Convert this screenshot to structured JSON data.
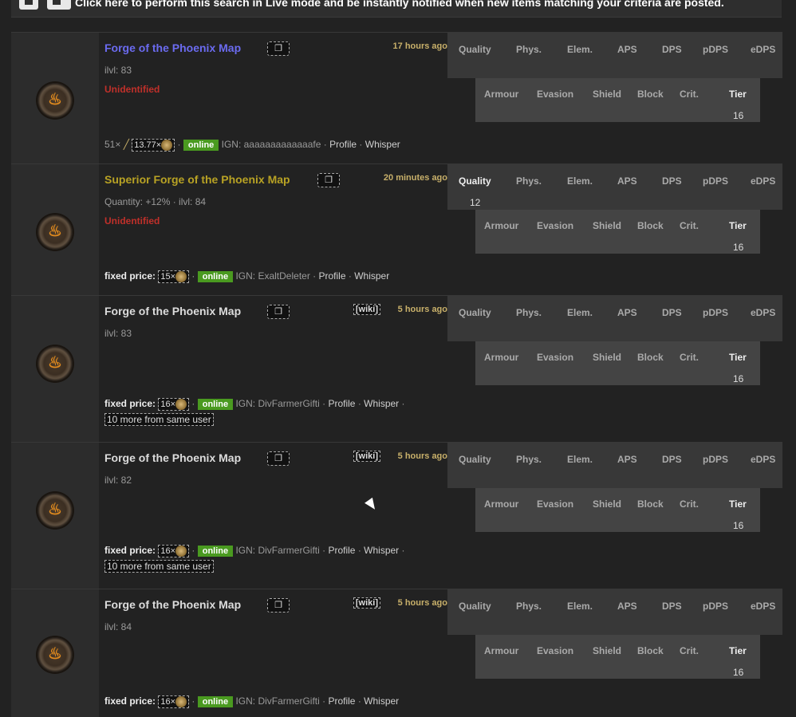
{
  "banner": {
    "text": "Click here to perform this search in Live mode and be instantly notified when new items matching your criteria are posted."
  },
  "headers": {
    "stats": [
      "Quality",
      "Phys.",
      "Elem.",
      "APS",
      "DPS",
      "pDPS",
      "eDPS"
    ],
    "defense": [
      "Armour",
      "Evasion",
      "Shield",
      "Block",
      "Crit.",
      "Tier"
    ]
  },
  "copy_icon": "clipboard-icon",
  "wiki_label": "[wiki]",
  "items": [
    {
      "title": "Forge of the Phoenix Map",
      "rarity": "magic",
      "time": "17 hours ago",
      "line1": "ilvl: 83",
      "unidentified": "Unidentified",
      "price_prefix": "51×",
      "price_amount": "13.77×",
      "price_label": "",
      "status": "online",
      "ign": "IGN: aaaaaaaaaaaaafe",
      "profile": "Profile",
      "whisper": "Whisper",
      "more": "",
      "quality": "",
      "tier": "16"
    },
    {
      "title": "Superior Forge of the Phoenix Map",
      "rarity": "superior",
      "time": "20 minutes ago",
      "line1": "Quantity: +12% · ilvl: 84",
      "unidentified": "Unidentified",
      "price_prefix": "",
      "price_amount": "15×",
      "price_label": "fixed price:",
      "status": "online",
      "ign": "IGN: ExaltDeleter",
      "profile": "Profile",
      "whisper": "Whisper",
      "more": "",
      "quality": "12",
      "tier": "16"
    },
    {
      "title": "Forge of the Phoenix Map",
      "rarity": "normal",
      "time": "5 hours ago",
      "line1": "ilvl: 83",
      "unidentified": "",
      "price_prefix": "",
      "price_amount": "16×",
      "price_label": "fixed price:",
      "status": "online",
      "ign": "IGN: DivFarmerGifti",
      "profile": "Profile",
      "whisper": "Whisper",
      "more": "10 more from same user",
      "quality": "",
      "tier": "16"
    },
    {
      "title": "Forge of the Phoenix Map",
      "rarity": "normal",
      "time": "5 hours ago",
      "line1": "ilvl: 82",
      "unidentified": "",
      "price_prefix": "",
      "price_amount": "16×",
      "price_label": "fixed price:",
      "status": "online",
      "ign": "IGN: DivFarmerGifti",
      "profile": "Profile",
      "whisper": "Whisper",
      "more": "10 more from same user",
      "quality": "",
      "tier": "16"
    },
    {
      "title": "Forge of the Phoenix Map",
      "rarity": "normal",
      "time": "5 hours ago",
      "line1": "ilvl: 84",
      "unidentified": "",
      "price_prefix": "",
      "price_amount": "16×",
      "price_label": "fixed price:",
      "status": "online",
      "ign": "IGN: DivFarmerGifti",
      "profile": "Profile",
      "whisper": "Whisper",
      "more": "",
      "quality": "",
      "tier": "16"
    }
  ]
}
